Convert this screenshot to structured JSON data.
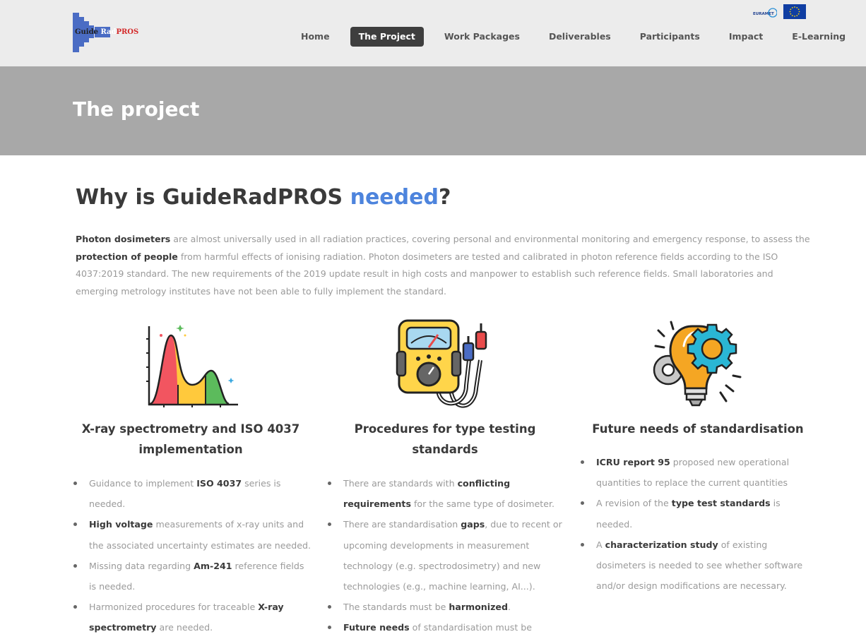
{
  "logo": {
    "part1": "Guide",
    "part2": "Rad",
    "part3": "PROS"
  },
  "partners": {
    "euramet": "EURAMET"
  },
  "nav": [
    {
      "label": "Home",
      "active": false
    },
    {
      "label": "The Project",
      "active": true
    },
    {
      "label": "Work Packages",
      "active": false
    },
    {
      "label": "Deliverables",
      "active": false
    },
    {
      "label": "Participants",
      "active": false
    },
    {
      "label": "Impact",
      "active": false
    },
    {
      "label": "E-Learning",
      "active": false
    }
  ],
  "banner": {
    "title": "The project"
  },
  "why": {
    "title_part1": "Why is GuideRadPROS ",
    "title_highlight": "needed",
    "title_part2": "?"
  },
  "intro": [
    {
      "text": "Photon dosimeters",
      "bold": true
    },
    {
      "text": " are almost universally used in all radiation practices, covering personal and environmental monitoring and emergency response, to assess the ",
      "bold": false
    },
    {
      "text": "protection of people",
      "bold": true
    },
    {
      "text": " from harmful effects of ionising radiation. Photon dosimeters are tested and calibrated in photon reference fields according to the ISO 4037:2019 standard. The new requirements of the 2019 update result in high costs and manpower to establish such reference fields. Small laboratories and emerging metrology institutes have not been able to fully implement the standard.",
      "bold": false
    }
  ],
  "columns": [
    {
      "icon": "spectrum-chart-icon",
      "title": "X-ray spectrometry and ISO 4037 implementation",
      "items": [
        [
          {
            "text": "Guidance to implement ",
            "bold": false
          },
          {
            "text": "ISO 4037",
            "bold": true
          },
          {
            "text": " series is needed.",
            "bold": false
          }
        ],
        [
          {
            "text": "High voltage",
            "bold": true
          },
          {
            "text": " measurements of x-ray units and the associated uncertainty estimates are needed.",
            "bold": false
          }
        ],
        [
          {
            "text": "Missing data regarding ",
            "bold": false
          },
          {
            "text": "Am-241",
            "bold": true
          },
          {
            "text": " reference fields is needed.",
            "bold": false
          }
        ],
        [
          {
            "text": "Harmonized procedures for traceable ",
            "bold": false
          },
          {
            "text": "X-ray spectrometry",
            "bold": true
          },
          {
            "text": " are needed.",
            "bold": false
          }
        ]
      ]
    },
    {
      "icon": "multimeter-icon",
      "title": "Procedures for type testing standards",
      "items": [
        [
          {
            "text": "There are standards with ",
            "bold": false
          },
          {
            "text": "conflicting requirements",
            "bold": true
          },
          {
            "text": " for the same type of dosimeter.",
            "bold": false
          }
        ],
        [
          {
            "text": "There are standardisation ",
            "bold": false
          },
          {
            "text": "gaps",
            "bold": true
          },
          {
            "text": ", due to recent or upcoming developments in measurement technology (e.g. spectrodosimetry) and new technologies (e.g., machine learning, AI...).",
            "bold": false
          }
        ],
        [
          {
            "text": "The standards must be ",
            "bold": false
          },
          {
            "text": "harmonized",
            "bold": true
          },
          {
            "text": ".",
            "bold": false
          }
        ],
        [
          {
            "text": "Future needs",
            "bold": true
          },
          {
            "text": " of standardisation must be analysed.",
            "bold": false
          }
        ]
      ]
    },
    {
      "icon": "lightbulb-gears-icon",
      "title": "Future needs of standardisation",
      "items": [
        [
          {
            "text": "ICRU report 95",
            "bold": true
          },
          {
            "text": " proposed new operational quantities to replace the current quantities",
            "bold": false
          }
        ],
        [
          {
            "text": "A revision of the ",
            "bold": false
          },
          {
            "text": "type test standards",
            "bold": true
          },
          {
            "text": " is needed.",
            "bold": false
          }
        ],
        [
          {
            "text": "A ",
            "bold": false
          },
          {
            "text": "characterization study",
            "bold": true
          },
          {
            "text": " of existing dosimeters is needed to see whether software and/or design modifications are necessary.",
            "bold": false
          }
        ]
      ]
    }
  ]
}
